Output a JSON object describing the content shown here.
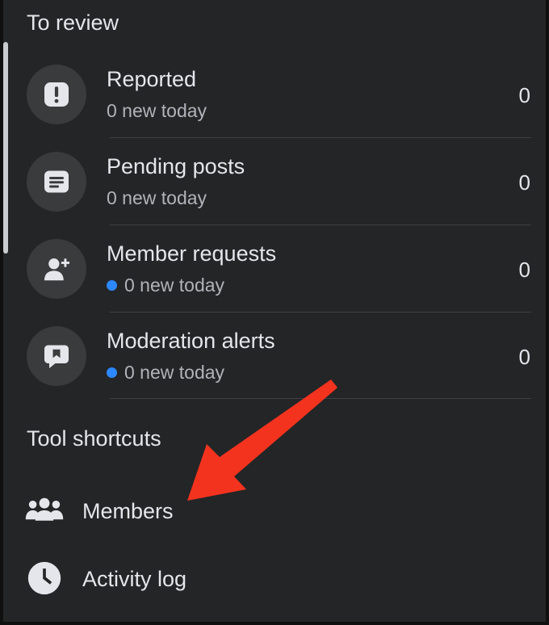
{
  "sections": {
    "review_title": "To review",
    "tools_title": "Tool shortcuts"
  },
  "review_items": [
    {
      "label": "Reported",
      "sub": "0 new today",
      "count": "0",
      "icon": "exclamation-icon",
      "dot": false
    },
    {
      "label": "Pending posts",
      "sub": "0 new today",
      "count": "0",
      "icon": "post-icon",
      "dot": false
    },
    {
      "label": "Member requests",
      "sub": "0 new today",
      "count": "0",
      "icon": "add-user-icon",
      "dot": true
    },
    {
      "label": "Moderation alerts",
      "sub": "0 new today",
      "count": "0",
      "icon": "alert-bubble-icon",
      "dot": true
    }
  ],
  "tool_items": [
    {
      "label": "Members",
      "icon": "people-icon"
    },
    {
      "label": "Activity log",
      "icon": "clock-icon"
    }
  ],
  "colors": {
    "background": "#242526",
    "icon_circle": "#3a3b3c",
    "text_primary": "#e4e6eb",
    "text_secondary": "#b0b3b8",
    "unread_dot": "#2d88ff",
    "annotation_arrow": "#f4331f"
  }
}
